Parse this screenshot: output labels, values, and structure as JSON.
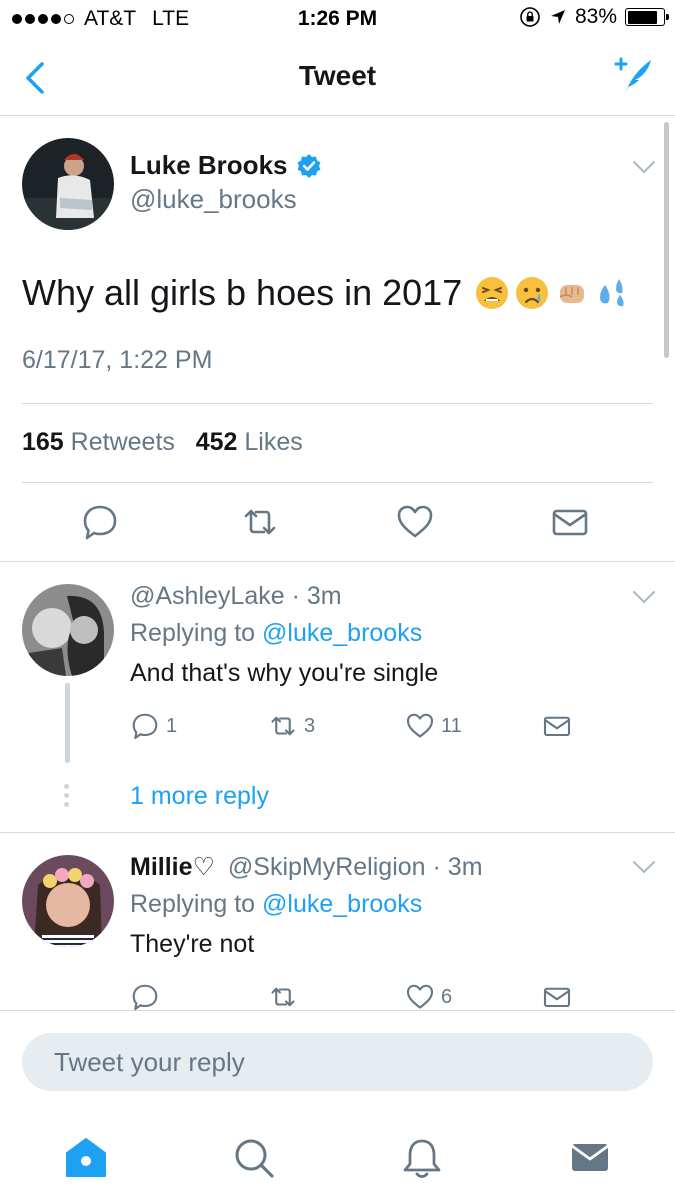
{
  "status_bar": {
    "carrier": "AT&T",
    "network": "LTE",
    "time": "1:26 PM",
    "battery": "83%",
    "battery_level": 0.83
  },
  "nav": {
    "title": "Tweet",
    "back_icon": "chevron-left-icon",
    "compose_icon": "compose-tweet-icon"
  },
  "tweet": {
    "author_name": "Luke Brooks",
    "verified": true,
    "handle": "@luke_brooks",
    "text": "Why all girls b hoes in 2017",
    "emojis": [
      "tired-face-emoji",
      "crying-face-emoji",
      "fist-emoji",
      "sweat-droplets-emoji"
    ],
    "timestamp": "6/17/17, 1:22 PM",
    "retweets_count": "165",
    "retweets_label": "Retweets",
    "likes_count": "452",
    "likes_label": "Likes"
  },
  "replies": [
    {
      "name": "",
      "handle": "@AshleyLake",
      "time": "· 3m",
      "replying_prefix": "Replying to",
      "replying_to": "@luke_brooks",
      "text": "And that's why you're single",
      "reply_count": "1",
      "retweet_count": "3",
      "like_count": "11"
    },
    {
      "name": "Millie♡",
      "handle": "@SkipMyReligion",
      "time": "· 3m",
      "replying_prefix": "Replying to",
      "replying_to": "@luke_brooks",
      "text": "They're not",
      "reply_count": "",
      "retweet_count": "",
      "like_count": "6"
    }
  ],
  "more_replies": "1 more reply",
  "composer": {
    "placeholder": "Tweet your reply"
  },
  "tabs": [
    "home-icon",
    "search-icon",
    "notifications-icon",
    "messages-icon"
  ],
  "colors": {
    "accent": "#1da1f2",
    "text_primary": "#14171a",
    "text_secondary": "#657786",
    "divider": "#d6d9db",
    "input_bg": "#e6ecf0"
  }
}
